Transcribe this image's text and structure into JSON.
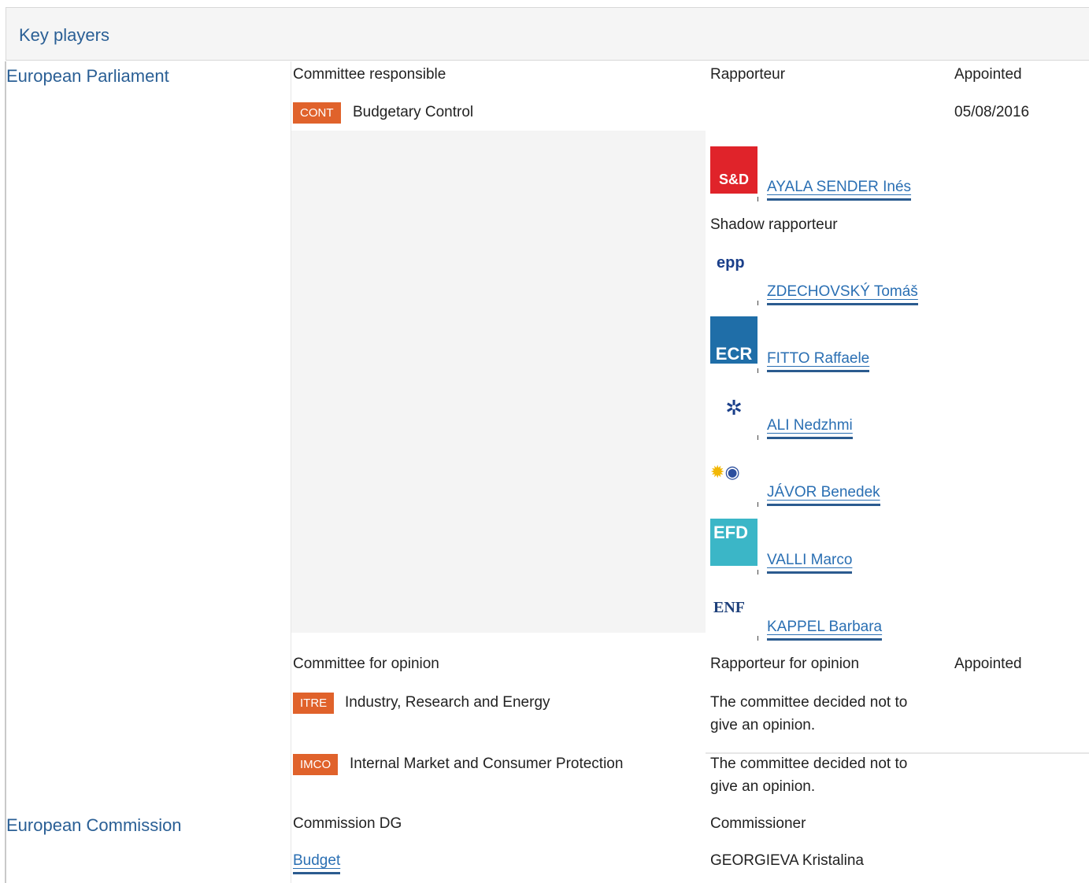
{
  "header": {
    "title": "Key players"
  },
  "parliament": {
    "section_title": "European Parliament",
    "responsible": {
      "col_committee": "Committee responsible",
      "col_rapporteur": "Rapporteur",
      "col_appointed": "Appointed",
      "committee_code": "CONT",
      "committee_name": "Budgetary Control",
      "appointed_date": "05/08/2016",
      "rapporteur": {
        "group_logo": "S&D",
        "name": "AYALA SENDER Inés"
      },
      "shadow_label": "Shadow rapporteur",
      "shadows": [
        {
          "group_logo": "epp",
          "name": "ZDECHOVSKÝ Tomáš"
        },
        {
          "group_logo": "ECR",
          "name": "FITTO Raffaele"
        },
        {
          "group_logo": "alde-stars",
          "name": "ALI Nedzhmi"
        },
        {
          "group_logo": "greens-sunflower",
          "name": "JÁVOR Benedek"
        },
        {
          "group_logo": "EFD",
          "name": "VALLI Marco"
        },
        {
          "group_logo": "ENF",
          "name": "KAPPEL Barbara"
        }
      ]
    },
    "opinion": {
      "col_committee": "Committee for opinion",
      "col_rapporteur": "Rapporteur for opinion",
      "col_appointed": "Appointed",
      "rows": [
        {
          "code": "ITRE",
          "name": "Industry, Research and Energy",
          "note_line1": "The committee decided not to",
          "note_line2": "give an opinion."
        },
        {
          "code": "IMCO",
          "name": "Internal Market and Consumer Protection",
          "note_line1": "The committee decided not to",
          "note_line2": "give an opinion."
        }
      ]
    }
  },
  "commission": {
    "section_title": "European Commission",
    "col_dg": "Commission DG",
    "col_commissioner": "Commissioner",
    "dg": "Budget",
    "commissioner": "GEORGIEVA Kristalina"
  },
  "colors": {
    "accent_blue": "#2a5f95",
    "link_blue": "#2a6fb3",
    "badge_orange": "#e0622b"
  }
}
